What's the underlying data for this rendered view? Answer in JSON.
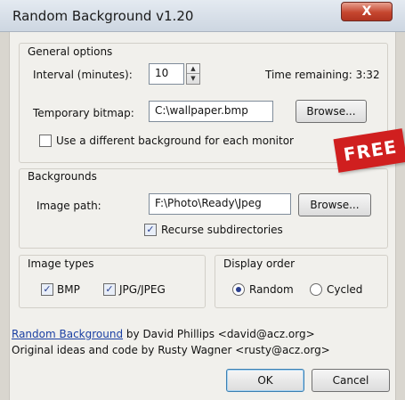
{
  "window": {
    "title": "Random Background v1.20",
    "close_label": "X"
  },
  "general": {
    "label": "General options",
    "interval_label": "Interval (minutes):",
    "interval_value": "10",
    "time_remaining_label": "Time remaining: 3:32",
    "bitmap_label": "Temporary bitmap:",
    "bitmap_value": "C:\\wallpaper.bmp",
    "browse_label": "Browse...",
    "multi_monitor_label": "Use a different background for each monitor",
    "multi_monitor_checked": false
  },
  "backgrounds": {
    "label": "Backgrounds",
    "image_path_label": "Image path:",
    "image_path_value": "F:\\Photo\\Ready\\Jpeg",
    "browse_label": "Browse...",
    "recurse_label": "Recurse subdirectories",
    "recurse_checked": true
  },
  "image_types": {
    "label": "Image types",
    "bmp_label": "BMP",
    "bmp_checked": true,
    "jpg_label": "JPG/JPEG",
    "jpg_checked": true
  },
  "display_order": {
    "label": "Display order",
    "random_label": "Random",
    "random_selected": true,
    "cycled_label": "Cycled",
    "cycled_selected": false
  },
  "credits": {
    "link_text": "Random Background",
    "line1_rest": " by David Phillips <david@acz.org>",
    "line2": "Original ideas and code by Rusty Wagner <rusty@acz.org>"
  },
  "buttons": {
    "ok_label": "OK",
    "cancel_label": "Cancel"
  },
  "badge": {
    "free_label": "FREE"
  }
}
